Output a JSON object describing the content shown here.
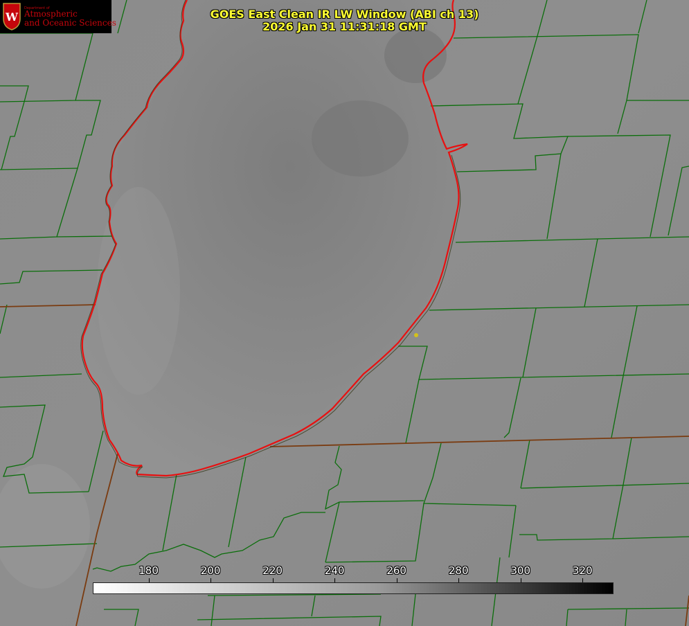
{
  "title": {
    "line1": "GOES East Clean IR LW Window (ABI ch 13)",
    "line2": "2026 Jan 31 11:31:18 GMT"
  },
  "logo": {
    "department": "Department of",
    "line1": "Atmospheric",
    "line2": "and Oceanic Sciences",
    "crest_letter": "W",
    "crest_color": "#c5050c"
  },
  "colorbar": {
    "ticks": [
      "180",
      "200",
      "220",
      "240",
      "260",
      "280",
      "300",
      "320"
    ],
    "range": [
      162,
      330
    ],
    "low_color": "#ffffff",
    "high_color": "#000000"
  },
  "colors": {
    "county_lines": "#0b6e0b",
    "coastline": "#e81010",
    "state_lines": "#7a3b10",
    "station_dot": "#d4c21a",
    "title_text": "#ffff33"
  }
}
